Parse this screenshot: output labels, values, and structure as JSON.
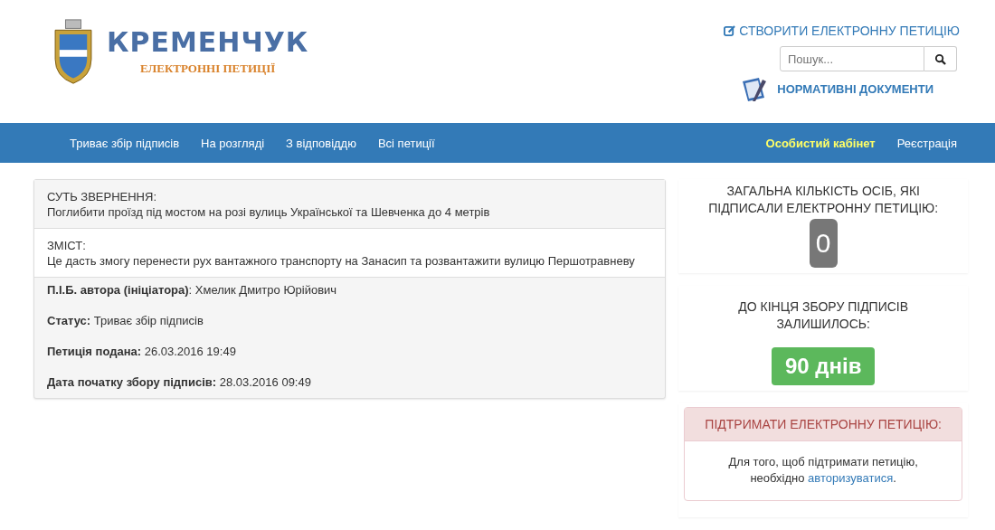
{
  "header": {
    "logo_title": "КРЕМЕНЧУК",
    "logo_subtitle": "ЕЛЕКТРОННІ ПЕТИЦІЇ",
    "create_link": "СТВОРИТИ ЕЛЕКТРОННУ ПЕТИЦІЮ",
    "search": {
      "placeholder": "Пошук..."
    },
    "documents_link": "НОРМАТИВНІ ДОКУМЕНТИ"
  },
  "nav": {
    "left": [
      {
        "label": "Триває збір підписів",
        "selected": false
      },
      {
        "label": "На розгляді",
        "selected": false
      },
      {
        "label": "З відповіддю",
        "selected": false
      },
      {
        "label": "Всі петиції",
        "selected": false
      }
    ],
    "right": [
      {
        "label": "Особистий кабінет",
        "selected": true
      },
      {
        "label": "Реєстрація",
        "selected": false
      }
    ]
  },
  "petition": {
    "sections": [
      {
        "heading": "СУТЬ ЗВЕРНЕННЯ:",
        "text": "Поглибити проїзд під мостом на розі вулиць Української та Шевченка до 4 метрів"
      },
      {
        "heading": "ЗМІСТ:",
        "text": "Це дасть змогу перенести рух вантажного транспорту на Занасип та розвантажити вулицю Першотравневу"
      }
    ],
    "details": [
      "**П.І.Б. автора (ініціатора)**: Хмелик Дмитро Юрійович",
      "**Статус:** Триває збір підписів",
      "**Петиція подана:** 26.03.2016 19:49",
      "**Дата початку збору підписів:** 28.03.2016 09:49"
    ]
  },
  "sidebar": {
    "signatures_label": "ЗАГАЛЬНА КІЛЬКІСТЬ ОСІБ, ЯКІ ПІДПИСАЛИ ЕЛЕКТРОННУ ПЕТИЦІЮ:",
    "signatures_count": "0",
    "remaining_label": "ДО КІНЦЯ ЗБОРУ ПІДПИСІВ ЗАЛИШИЛОСЬ:",
    "remaining_value": "90 днів",
    "support": {
      "title": "ПІДТРИМАТИ ЕЛЕКТРОННУ ПЕТИЦІЮ:",
      "text_before": "Для того, щоб підтримати петицію, необхідно",
      "link": "авторизуватися",
      "text_after": "."
    }
  }
}
